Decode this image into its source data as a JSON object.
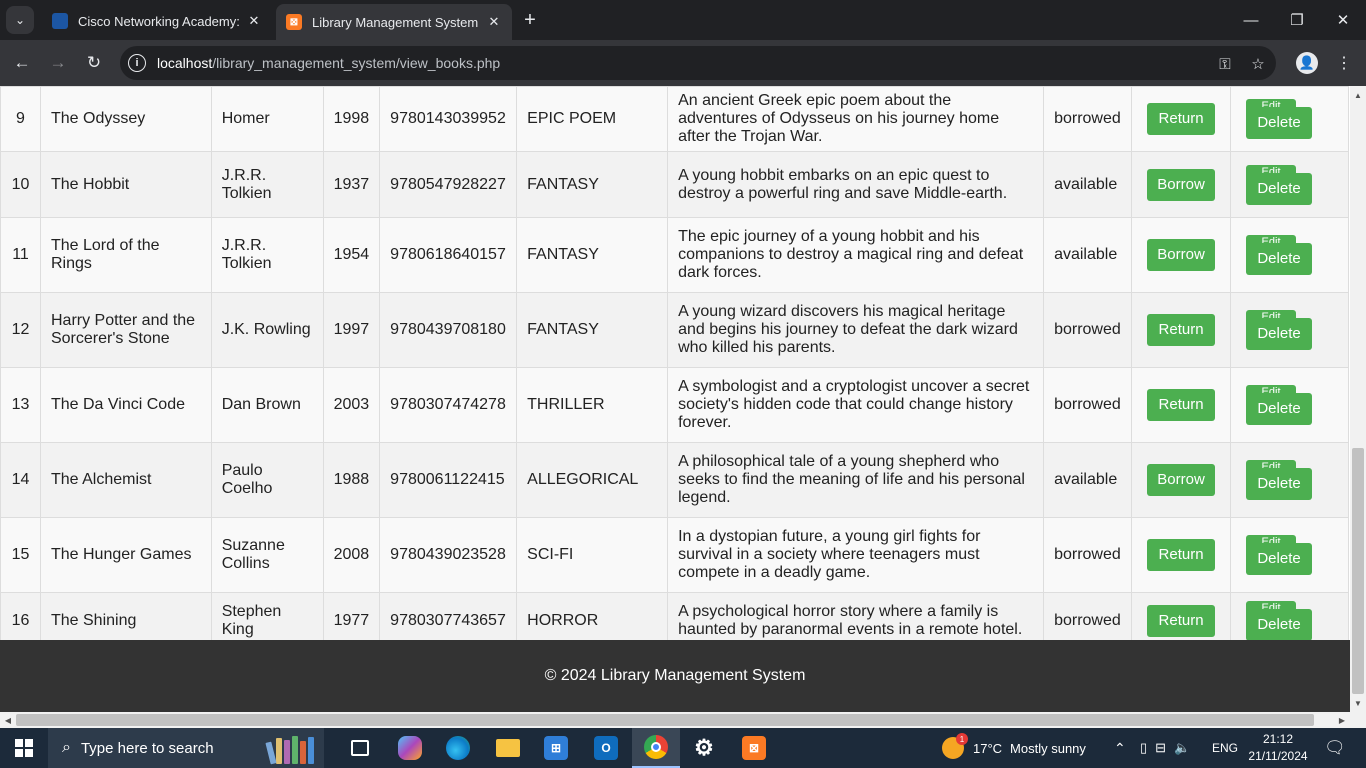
{
  "browser": {
    "tabs": [
      {
        "title": "Cisco Networking Academy: Le",
        "active": false
      },
      {
        "title": "Library Management System",
        "active": true
      }
    ],
    "url_host": "localhost",
    "url_path": "/library_management_system/view_books.php"
  },
  "table": {
    "rows": [
      {
        "id": "9",
        "title": "The Odyssey",
        "author": "Homer",
        "year": "1998",
        "isbn": "9780143039952",
        "genre": "EPIC POEM",
        "description": "An ancient Greek epic poem about the adventures of Odysseus on his journey home after the Trojan War.",
        "status": "borrowed",
        "action": "Return"
      },
      {
        "id": "10",
        "title": "The Hobbit",
        "author": "J.R.R. Tolkien",
        "year": "1937",
        "isbn": "9780547928227",
        "genre": "FANTASY",
        "description": "A young hobbit embarks on an epic quest to destroy a powerful ring and save Middle-earth.",
        "status": "available",
        "action": "Borrow"
      },
      {
        "id": "11",
        "title": "The Lord of the Rings",
        "author": "J.R.R. Tolkien",
        "year": "1954",
        "isbn": "9780618640157",
        "genre": "FANTASY",
        "description": "The epic journey of a young hobbit and his companions to destroy a magical ring and defeat dark forces.",
        "status": "available",
        "action": "Borrow"
      },
      {
        "id": "12",
        "title": "Harry Potter and the Sorcerer's Stone",
        "author": "J.K. Rowling",
        "year": "1997",
        "isbn": "9780439708180",
        "genre": "FANTASY",
        "description": "A young wizard discovers his magical heritage and begins his journey to defeat the dark wizard who killed his parents.",
        "status": "borrowed",
        "action": "Return"
      },
      {
        "id": "13",
        "title": "The Da Vinci Code",
        "author": "Dan Brown",
        "year": "2003",
        "isbn": "9780307474278",
        "genre": "THRILLER",
        "description": "A symbologist and a cryptologist uncover a secret society's hidden code that could change history forever.",
        "status": "borrowed",
        "action": "Return"
      },
      {
        "id": "14",
        "title": "The Alchemist",
        "author": "Paulo Coelho",
        "year": "1988",
        "isbn": "9780061122415",
        "genre": "ALLEGORICAL",
        "description": "A philosophical tale of a young shepherd who seeks to find the meaning of life and his personal legend.",
        "status": "available",
        "action": "Borrow"
      },
      {
        "id": "15",
        "title": "The Hunger Games",
        "author": "Suzanne Collins",
        "year": "2008",
        "isbn": "9780439023528",
        "genre": "SCI-FI",
        "description": "In a dystopian future, a young girl fights for survival in a society where teenagers must compete in a deadly game.",
        "status": "borrowed",
        "action": "Return"
      },
      {
        "id": "16",
        "title": "The Shining",
        "author": "Stephen King",
        "year": "1977",
        "isbn": "9780307743657",
        "genre": "HORROR",
        "description": "A psychological horror story where a family is haunted by paranormal events in a remote hotel.",
        "status": "borrowed",
        "action": "Return"
      }
    ],
    "edit_label": "Edit",
    "delete_label": "Delete"
  },
  "footer": {
    "text": "© 2024 Library Management System"
  },
  "taskbar": {
    "search_placeholder": "Type here to search",
    "weather": {
      "temp": "17°C",
      "condition": "Mostly sunny",
      "badge": "1"
    },
    "language": "ENG",
    "time": "21:12",
    "date": "21/11/2024"
  },
  "colors": {
    "button_green": "#4caf50",
    "footer_bg": "#333333",
    "chrome_dark": "#202124",
    "chrome_toolbar": "#35363a"
  }
}
